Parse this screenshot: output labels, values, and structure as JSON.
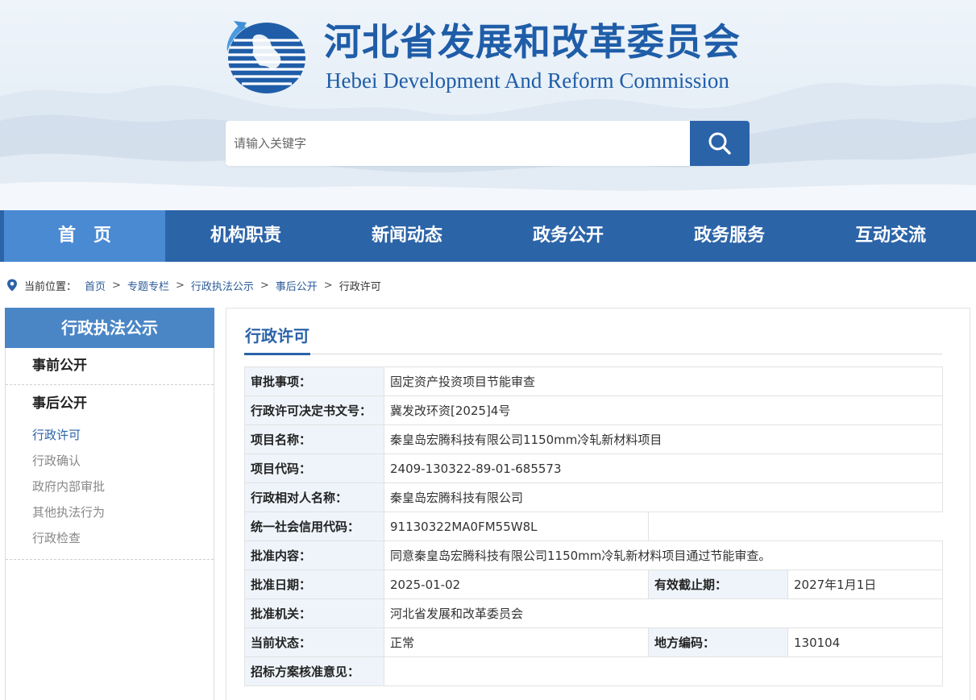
{
  "header": {
    "title_cn": "河北省发展和改革委员会",
    "title_en": "Hebei Development And Reform Commission",
    "search_placeholder": "请输入关键字"
  },
  "colors": {
    "brand": "#2c64a8",
    "nav_active": "#4a8ad3",
    "link": "#2b5a98",
    "label_bg": "#eef4fa"
  },
  "nav": {
    "items": [
      {
        "label": "首　页",
        "active": true
      },
      {
        "label": "机构职责"
      },
      {
        "label": "新闻动态"
      },
      {
        "label": "政务公开"
      },
      {
        "label": "政务服务"
      },
      {
        "label": "互动交流"
      }
    ]
  },
  "breadcrumb": {
    "prefix": "当前位置：",
    "items": [
      "首页",
      "专题专栏",
      "行政执法公示",
      "事后公开"
    ],
    "current": "行政许可",
    "sep": ">"
  },
  "sidebar": {
    "title": "行政执法公示",
    "sections": [
      "事前公开",
      "事后公开"
    ],
    "sub_items": [
      "行政许可",
      "行政确认",
      "政府内部审批",
      "其他执法行为",
      "行政检查"
    ],
    "active_sub": "行政许可"
  },
  "main": {
    "title": "行政许可",
    "rows": {
      "approval_item": {
        "label": "审批事项：",
        "value": "固定资产投资项目节能审查"
      },
      "decision_no": {
        "label": "行政许可决定书文号：",
        "value": "冀发改环资[2025]4号"
      },
      "project_name": {
        "label": "项目名称：",
        "value": "秦皇岛宏腾科技有限公司1150mm冷轧新材料项目"
      },
      "project_code": {
        "label": "项目代码：",
        "value": "2409-130322-89-01-685573"
      },
      "counterparty": {
        "label": "行政相对人名称：",
        "value": "秦皇岛宏腾科技有限公司"
      },
      "credit_code": {
        "label": "统一社会信用代码：",
        "value": "91130322MA0FM55W8L"
      },
      "approval_content": {
        "label": "批准内容：",
        "value": "同意秦皇岛宏腾科技有限公司1150mm冷轧新材料项目通过节能审查。"
      },
      "approval_date": {
        "label": "批准日期：",
        "value": "2025-01-02"
      },
      "valid_until": {
        "label": "有效截止期：",
        "value": "2027年1月1日"
      },
      "approval_org": {
        "label": "批准机关：",
        "value": "河北省发展和改革委员会"
      },
      "status": {
        "label": "当前状态：",
        "value": "正常"
      },
      "region_code": {
        "label": "地方编码：",
        "value": "130104"
      },
      "bidding_opinion": {
        "label": "招标方案核准意见：",
        "value": ""
      }
    }
  }
}
